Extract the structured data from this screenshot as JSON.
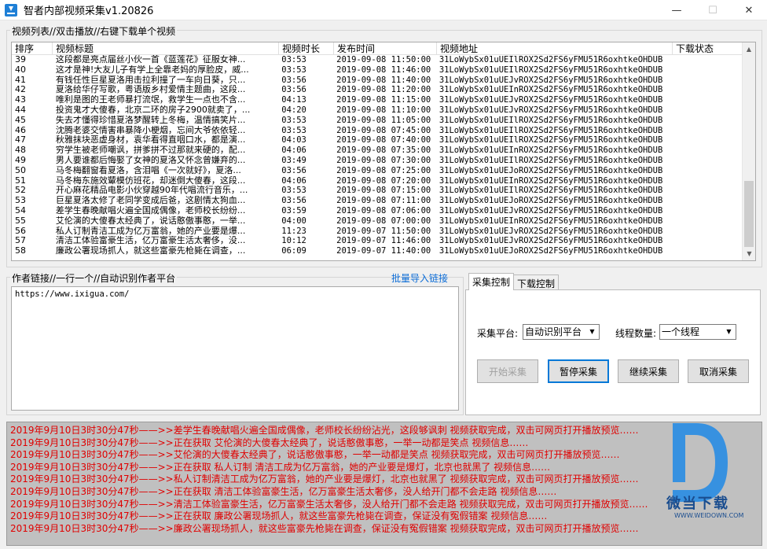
{
  "window": {
    "title": "智者内部视频采集v1.20826",
    "minimize": "—",
    "maximize": "☐",
    "close": "✕"
  },
  "video_list": {
    "group_label": "视频列表//双击播放//右键下载单个视频",
    "columns": [
      "排序",
      "视频标题",
      "视频时长",
      "发布时间",
      "视频地址",
      "下载状态"
    ],
    "rows": [
      {
        "idx": "39",
        "title": "这段都是亮点届丝小伙一首《蓝莲花》征服女神...",
        "dur": "03:53",
        "date": "2019-09-08 11:50:00",
        "url": "31LoWybSx01uUEIlROX2Sd2FS6yFMU51R6oxhtkeOHDUB",
        "status": ""
      },
      {
        "idx": "40",
        "title": "这才是神!大友儿子有学上全靠老妈的厚脸皮，威...",
        "dur": "03:53",
        "date": "2019-09-08 11:46:00",
        "url": "31LoWybSx01uUEIlROX2Sd2FS6yFMU51R6oxhtkeOHDUB",
        "status": ""
      },
      {
        "idx": "41",
        "title": "有钱任性巨星夏洛用击拉利撞了一车向日葵，只...",
        "dur": "03:56",
        "date": "2019-09-08 11:40:00",
        "url": "31LoWybSx01uUEJvROX2Sd2FS6yFMU51R6oxhtkeOHDUB",
        "status": ""
      },
      {
        "idx": "42",
        "title": "夏洛给华仔写歌，粤语版乡村爱情主题曲，这段...",
        "dur": "03:56",
        "date": "2019-09-08 11:20:00",
        "url": "31LoWybSx01uUEInROX2Sd2FS6yFMU51R6oxhtkeOHDUB",
        "status": ""
      },
      {
        "idx": "43",
        "title": "唯利是图的王老师暴打流氓，救学生一点也不含...",
        "dur": "04:13",
        "date": "2019-09-08 11:15:00",
        "url": "31LoWybSx01uUEJvROX2Sd2FS6yFMU51R6oxhtkeOHDUB",
        "status": ""
      },
      {
        "idx": "44",
        "title": "投资鬼才大傻春，北京二环的房子2900就卖了，...",
        "dur": "04:20",
        "date": "2019-09-08 11:10:00",
        "url": "31LoWybSx01uUEJvROX2Sd2FS6yFMU51R6oxhtkeOHDUB",
        "status": ""
      },
      {
        "idx": "45",
        "title": "失去才懂得珍惜夏洛梦醒转上冬梅，温情搞笑片...",
        "dur": "03:53",
        "date": "2019-09-08 11:05:00",
        "url": "31LoWybSx01uUEIlROX2Sd2FS6yFMU51R6oxhtkeOHDUB",
        "status": ""
      },
      {
        "idx": "46",
        "title": "沈腾老婆交情害串暴降小梗烟，忘间大爷依依轻...",
        "dur": "03:53",
        "date": "2019-09-08 07:45:00",
        "url": "31LoWybSx01uUEIlROX2Sd2FS6yFMU51R6oxhtkeOHDUB",
        "status": ""
      },
      {
        "idx": "47",
        "title": "秋雅抹块恶虚身材，袁华看得直咽口水，都是演...",
        "dur": "04:03",
        "date": "2019-09-08 07:40:00",
        "url": "31LoWybSx01uUEIlROX2Sd2FS6yFMU51R6oxhtkeOHDUB",
        "status": ""
      },
      {
        "idx": "48",
        "title": "穷学生被老师嘲讽，拼爹拼不过那就来硬的，配...",
        "dur": "04:06",
        "date": "2019-09-08 07:35:00",
        "url": "31LoWybSx01uUEInROX2Sd2FS6yFMU51R6oxhtkeOHDUB",
        "status": ""
      },
      {
        "idx": "49",
        "title": "男人要谁都后悔娶了女神的夏洛又怀念曾嫌弃的...",
        "dur": "03:49",
        "date": "2019-09-08 07:30:00",
        "url": "31LoWybSx01uUEIlROX2Sd2FS6yFMU51R6oxhtkeOHDUB",
        "status": ""
      },
      {
        "idx": "50",
        "title": "马冬梅翻窗看夏洛，含泪唱《一次就好》，夏洛...",
        "dur": "03:56",
        "date": "2019-09-08 07:25:00",
        "url": "31LoWybSx01uUEJoROX2Sd2FS6yFMU51R6oxhtkeOHDUB",
        "status": ""
      },
      {
        "idx": "51",
        "title": "马冬梅东施效颦模仿班花，却迷倒大傻春，这段...",
        "dur": "04:06",
        "date": "2019-09-08 07:20:00",
        "url": "31LoWybSx01uUEInROX2Sd2FS6yFMU51R6oxhtkeOHDUB",
        "status": ""
      },
      {
        "idx": "52",
        "title": "开心麻花精品电影小伙穿越90年代唱流行音乐，...",
        "dur": "03:53",
        "date": "2019-09-08 07:15:00",
        "url": "31LoWybSx01uUEIlROX2Sd2FS6yFMU51R6oxhtkeOHDUB",
        "status": ""
      },
      {
        "idx": "53",
        "title": "巨星夏洛太修了老同学变成后爸，这剧情太狗血...",
        "dur": "03:56",
        "date": "2019-09-08 07:11:00",
        "url": "31LoWybSx01uUEJoROX2Sd2FS6yFMU51R6oxhtkeOHDUB",
        "status": ""
      },
      {
        "idx": "54",
        "title": "差学生春晚献唱火遍全国成偶像，老师校长纷纷...",
        "dur": "03:59",
        "date": "2019-09-08 07:06:00",
        "url": "31LoWybSx01uUEJvROX2Sd2FS6yFMU51R6oxhtkeOHDUB",
        "status": ""
      },
      {
        "idx": "55",
        "title": "艾伦演的大傻春太经典了，说话憨傲事憨，一举...",
        "dur": "04:00",
        "date": "2019-09-08 07:00:00",
        "url": "31LoWybSx01uUEInROX2Sd2FS6yFMU51R6oxhtkeOHDUB",
        "status": ""
      },
      {
        "idx": "56",
        "title": "私人订制青洁工成为亿万富翁，她的产业要是爆...",
        "dur": "11:23",
        "date": "2019-09-07 11:50:00",
        "url": "31LoWybSx01uUEJvROX2Sd2FS6yFMU51R6oxhtkeOHDUB",
        "status": ""
      },
      {
        "idx": "57",
        "title": "清洁工体验富豪生活，亿万富豪生活太奢侈，没...",
        "dur": "10:12",
        "date": "2019-09-07 11:46:00",
        "url": "31LoWybSx01uUEJvROX2Sd2FS6yFMU51R6oxhtkeOHDUB",
        "status": ""
      },
      {
        "idx": "58",
        "title": "廉政公署现场抓人，就这些富豪先枪毙在调查，...",
        "dur": "06:09",
        "date": "2019-09-07 11:40:00",
        "url": "31LoWybSx01uUEJoROX2Sd2FS6yFMU51R6oxhtkeOHDUB",
        "status": ""
      }
    ]
  },
  "author": {
    "group_label": "作者链接//一行一个//自动识别作者平台",
    "batch_import_link": "批量导入链接",
    "textarea_value": "https://www.ixigua.com/"
  },
  "tabs": [
    "采集控制",
    "下载控制"
  ],
  "controls": {
    "platform_label": "采集平台:",
    "platform_value": "自动识别平台",
    "threads_label": "线程数量:",
    "threads_value": "一个线程",
    "start_button": "开始采集",
    "pause_button": "暂停采集",
    "resume_button": "继续采集",
    "cancel_button": "取消采集"
  },
  "log": [
    "2019年9月10日3时30分47秒——>>差学生春晚献唱火遍全国成偶像，老师校长纷纷沾光，这段够讽刺 视频获取完成，双击可网页打开播放预览……",
    "2019年9月10日3时30分47秒——>>正在获取 艾伦演的大傻春太经典了，说话憨傲事憨，一举一动都是笑点 视频信息……",
    "2019年9月10日3时30分47秒——>>艾伦演的大傻春太经典了，说话憨傲事憨，一举一动都是笑点 视频获取完成，双击可网页打开播放预览……",
    "2019年9月10日3时30分47秒——>>正在获取 私人订制 清洁工成为亿万富翁，她的产业要是爆灯，北京也就黑了 视频信息……",
    "2019年9月10日3时30分47秒——>>私人订制清洁工成为亿万富翁，她的产业要是爆灯，北京也就黑了 视频获取完成，双击可网页打开播放预览……",
    "2019年9月10日3时30分47秒——>>正在获取 清洁工体验富豪生活，亿万富豪生活太奢侈，没人给开门都不会走路 视频信息……",
    "2019年9月10日3时30分47秒——>>清洁工体验富豪生活，亿万富豪生活太奢侈，没人给开门都不会走路 视频获取完成，双击可网页打开播放预览……",
    "2019年9月10日3时30分47秒——>>正在获取 廉政公署现场抓人，就这些富豪先枪毙在调查，保证没有冤假错案 视频信息……",
    "2019年9月10日3时30分47秒——>>廉政公署现场抓人，就这些富豪先枪毙在调查，保证没有冤假错案 视频获取完成，双击可网页打开播放预览……"
  ],
  "watermark": {
    "brand": "微当下载",
    "url": "WWW.WEIDOWN.COM"
  },
  "colors": {
    "log_text": "#e00000",
    "log_bg": "#c0c0c0",
    "link": "#0a6bd6",
    "accent": "#0078d7"
  }
}
